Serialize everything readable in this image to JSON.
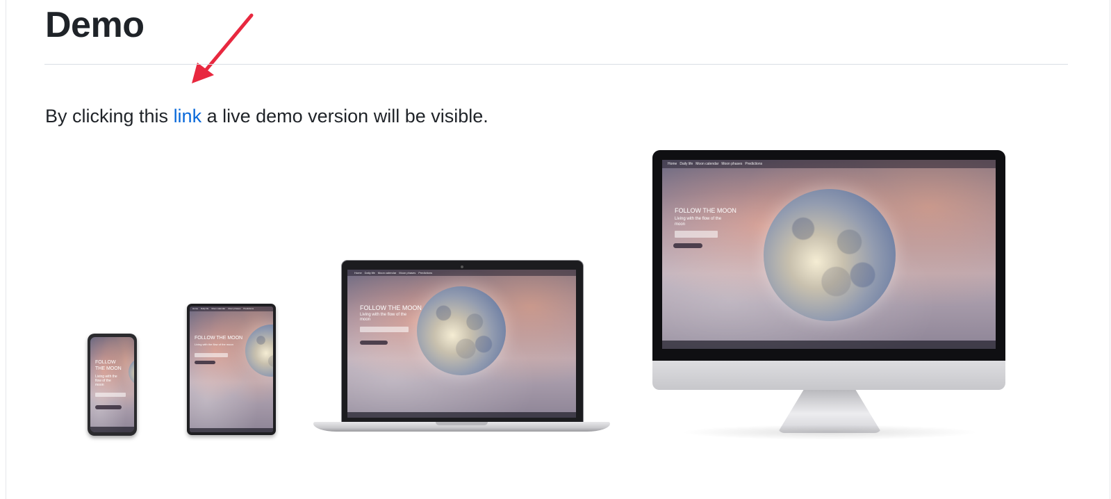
{
  "section": {
    "title": "Demo",
    "sentence_before": "By clicking this ",
    "link_text": "link",
    "sentence_after": " a live demo version will be visible."
  },
  "annotation": {
    "arrow_color": "#e8283f"
  },
  "mockup": {
    "hero_title": "FOLLOW THE MOON",
    "phone_title": "FOLLOW THE MOON",
    "hero_subtitle": "Living with the flow of the moon",
    "nav_items": [
      "Home",
      "Daily life",
      "Moon calendar",
      "Moon phases",
      "Predictions"
    ]
  },
  "colors": {
    "link": "#0969da",
    "heading": "#1f2328"
  }
}
